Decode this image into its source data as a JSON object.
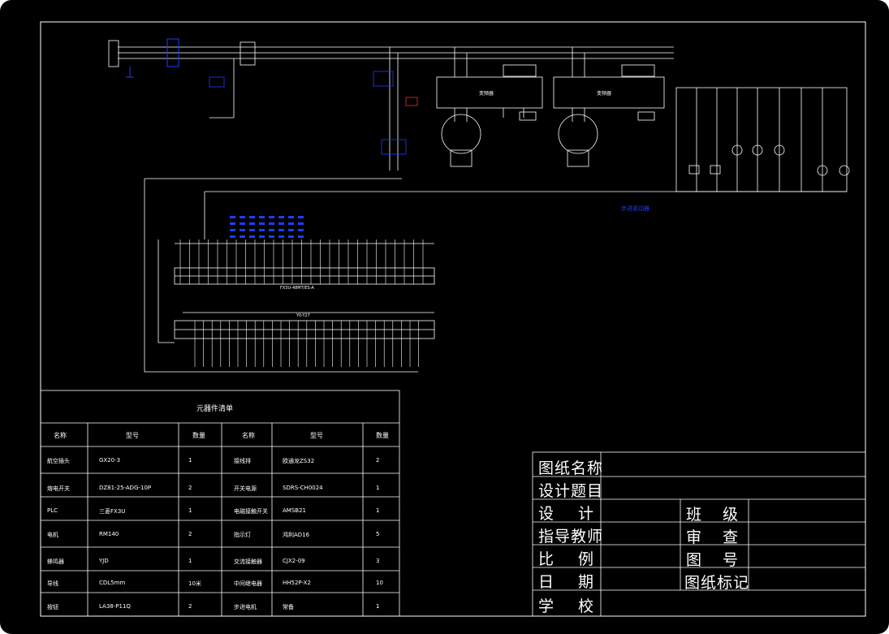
{
  "colors": {
    "background": "#000000",
    "line": "#ffffff",
    "accent_red": "#ff2a2a",
    "accent_blue": "#1e3cff"
  },
  "bom": {
    "title": "元器件清单",
    "headers": [
      "名称",
      "型号",
      "数量",
      "名称",
      "型号",
      "数量"
    ],
    "rows": [
      [
        "航空插头",
        "GX20-3",
        "1",
        "接线排",
        "欧通龙ZS32",
        "2"
      ],
      [
        "熔电开关",
        "DZ81-25-ADG-10P",
        "2",
        "开关电源",
        "SDRS-CH0024",
        "1"
      ],
      [
        "PLC",
        "三菱FX3U",
        "1",
        "电磁接触开关",
        "AMSB21",
        "1"
      ],
      [
        "电机",
        "RM140",
        "2",
        "指示灯",
        "鸿利AD16",
        "5"
      ],
      [
        "蜂鸣器",
        "YJD",
        "1",
        "交流接触器",
        "CJX2-09",
        "3"
      ],
      [
        "导线",
        "CDL5mm",
        "10米",
        "中间继电器",
        "HH52P-X2",
        "10"
      ],
      [
        "按钮",
        "LA38-P11Q",
        "2",
        "步进电机",
        "常备",
        "1"
      ]
    ]
  },
  "title_block": {
    "drawing_name": "图纸名称",
    "design_topic": "设计题目",
    "design": "设  计",
    "class": "班  级",
    "instructor": "指导教师",
    "review": "审  查",
    "scale": "比  例",
    "figure_no": "图  号",
    "date": "日  期",
    "drawing_mark": "图纸标记",
    "school": "学  校"
  },
  "diagram": {
    "motor1_label": "变频器",
    "motor2_label": "变频器",
    "plc_model": "FX3U-48MT/ES-A",
    "terminal_label": "Y0-Y27",
    "blue_note": "步进驱动器"
  }
}
